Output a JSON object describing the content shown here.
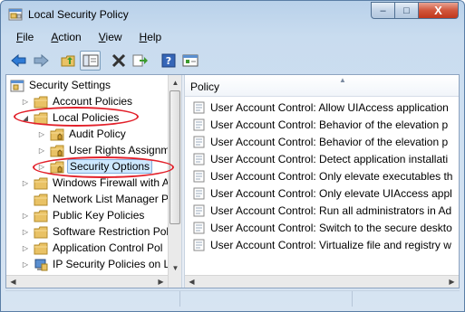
{
  "window": {
    "title": "Local Security Policy",
    "minimize_label": "–",
    "maximize_label": "□",
    "close_label": "X"
  },
  "menu": [
    {
      "label": "File",
      "accel": "F",
      "rest": "ile"
    },
    {
      "label": "Action",
      "accel": "A",
      "rest": "ction"
    },
    {
      "label": "View",
      "accel": "V",
      "rest": "iew"
    },
    {
      "label": "Help",
      "accel": "H",
      "rest": "elp"
    }
  ],
  "toolbar": [
    "back-icon",
    "forward-icon",
    "up-folder-icon",
    "show-hide-tree-icon",
    "delete-icon",
    "export-list-icon",
    "help-icon",
    "properties-icon"
  ],
  "tree": {
    "root": "Security Settings",
    "items": [
      {
        "label": "Account Policies",
        "level": 1,
        "expander": "▷"
      },
      {
        "label": "Local Policies",
        "level": 1,
        "expander": "◢"
      },
      {
        "label": "Audit Policy",
        "level": 2,
        "expander": "▷"
      },
      {
        "label": "User Rights Assignm",
        "level": 2,
        "expander": "▷"
      },
      {
        "label": "Security Options",
        "level": 2,
        "expander": "▷"
      },
      {
        "label": "Windows Firewall with A",
        "level": 1,
        "expander": "▷"
      },
      {
        "label": "Network List Manager P",
        "level": 1,
        "expander": ""
      },
      {
        "label": "Public Key Policies",
        "level": 1,
        "expander": "▷"
      },
      {
        "label": "Software Restriction Pol",
        "level": 1,
        "expander": "▷"
      },
      {
        "label": "Application Control Pol",
        "level": 1,
        "expander": "▷"
      },
      {
        "label": "IP Security Policies on L",
        "level": 1,
        "expander": "▷"
      }
    ]
  },
  "list": {
    "column_header": "Policy",
    "rows": [
      "User Account Control: Allow UIAccess application",
      "User Account Control: Behavior of the elevation p",
      "User Account Control: Behavior of the elevation p",
      "User Account Control: Detect application installati",
      "User Account Control: Only elevate executables th",
      "User Account Control: Only elevate UIAccess appl",
      "User Account Control: Run all administrators in Ad",
      "User Account Control: Switch to the secure deskto",
      "User Account Control: Virtualize file and registry w"
    ]
  },
  "colors": {
    "annotation_circle": "#e2202a",
    "folder": "#e9c265",
    "selection": "#cde8ff"
  }
}
